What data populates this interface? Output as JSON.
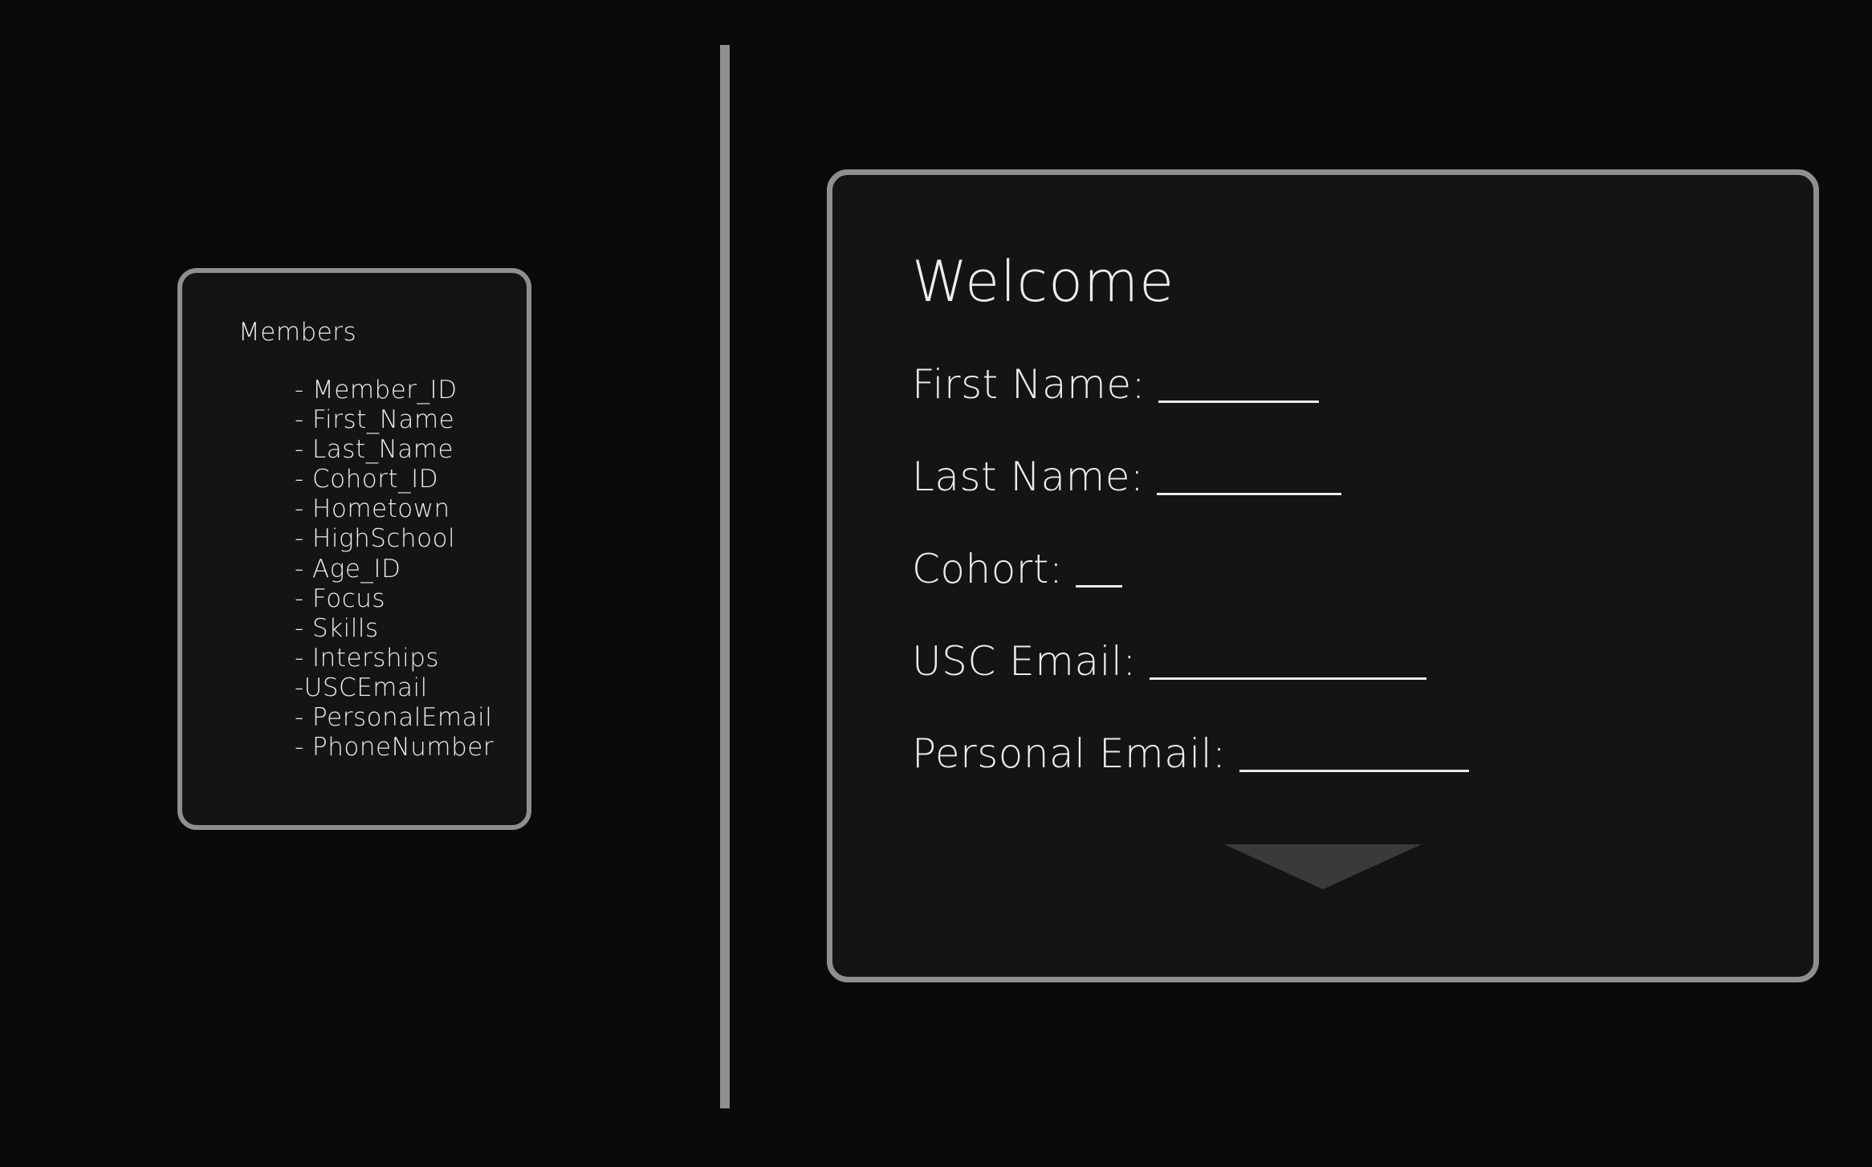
{
  "members_panel": {
    "title": "Members",
    "fields": [
      "- Member_ID",
      "- First_Name",
      "- Last_Name",
      "- Cohort_ID",
      "- Hometown",
      "- HighSchool",
      "- Age_ID",
      "- Focus",
      "- Skills",
      "- Interships",
      "-USCEmail",
      "- PersonalEmail",
      "- PhoneNumber"
    ]
  },
  "welcome_form": {
    "title": "Welcome",
    "fields": {
      "first_name": {
        "label": "First Name:",
        "value": ""
      },
      "last_name": {
        "label": "Last Name:",
        "value": ""
      },
      "cohort": {
        "label": "Cohort:",
        "value": ""
      },
      "usc_email": {
        "label": "USC Email:",
        "value": ""
      },
      "personal_email": {
        "label": "Personal Email:",
        "value": ""
      }
    },
    "submit_icon": "triangle-down-icon"
  },
  "colors": {
    "background": "#0a0a0a",
    "card_background": "#141414",
    "border": "#8f8f8f",
    "text": "#ececec",
    "arrow": "#3a3a3a"
  }
}
